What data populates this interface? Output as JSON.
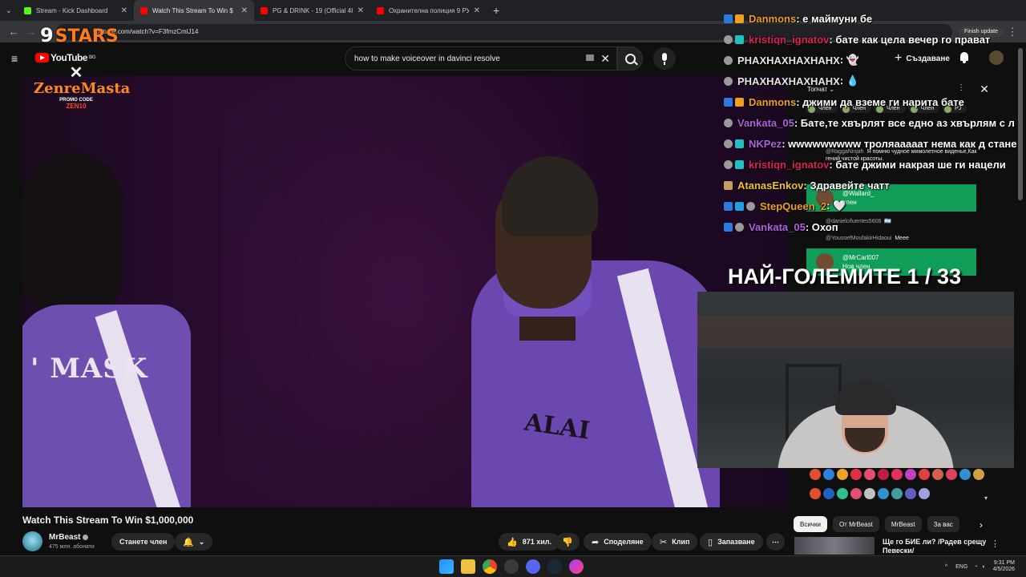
{
  "browser": {
    "tabs": [
      {
        "title": "Stream - Kick Dashboard",
        "color": "#53fc18",
        "active": false
      },
      {
        "title": "Watch This Stream To Win $",
        "color": "#ff0000",
        "active": true
      },
      {
        "title": "PG & DRINK - 19 (Official 4K V",
        "color": "#ff0000",
        "active": false
      },
      {
        "title": "Охранителна полиция 9 РУ | Г",
        "color": "#ff0000",
        "active": false
      }
    ],
    "new_tab": "+",
    "url": "youtube.com/watch?v=F3fmzCmlJ14",
    "finish_update": "Finish update"
  },
  "youtube": {
    "logo_text": "YouTube",
    "logo_region": "BG",
    "search_value": "how to make voiceover in davinci resolve",
    "create_label": "Създаване",
    "video_title": "Watch This Stream To Win $1,000,000",
    "channel_name": "MrBeast",
    "channel_subs": "475 млн. абонати",
    "join_label": "Станете член",
    "likes": "871 хил.",
    "share_label": "Споделяне",
    "clip_label": "Клип",
    "save_label": "Запазване",
    "more_label": "⋯",
    "chips": [
      "Всички",
      "От MrBeast",
      "MrBeast",
      "За вас"
    ],
    "rec_title": "Ще го БИЕ ли? /Радев срещу Певески/"
  },
  "overlay": {
    "stars_num": "9",
    "stars_text": "STARS",
    "zen_x": "✕",
    "zen_name": "ZenreMasta",
    "zen_promo": "PROMO CODE",
    "zen_code": "ZEN10",
    "big_title": "НАЙ-ГОЛЕМИТЕ 1 / 33",
    "top_chat_label": "Топчат",
    "members": [
      "Член",
      "Член",
      "Член",
      "Член",
      "PJ"
    ],
    "side_comments": [
      {
        "user": "@RaggaNinjah",
        "text": "Я помню чудное мимолетное виденье,Как гений чистой красоты."
      },
      {
        "user": "@danielcifuentes5606",
        "text": "🇦🇷"
      },
      {
        "user": "@YoussefMoufakirHidaoui",
        "text": "Meee"
      }
    ],
    "green_comments": [
      {
        "user": "@Wallard_",
        "text": "член"
      },
      {
        "user": "@MrCarl007",
        "text": "Нов член"
      }
    ]
  },
  "chat": [
    {
      "user": "Danmons",
      "color": "#f0a020",
      "text": ": е маймуни бе"
    },
    {
      "user": "kristiqn_ignatov",
      "color": "#e0205a",
      "text": ": бате как цела вечер го прават"
    },
    {
      "user": "PHAXHAXHAXHAHX",
      "color": "#e6e6e6",
      "text": ": 👻"
    },
    {
      "user": "PHAXHAXHAXHAHX",
      "color": "#e6e6e6",
      "text": ": 💧"
    },
    {
      "user": "Danmons",
      "color": "#f0a020",
      "text": ": джими да вземе ги нарита бате"
    },
    {
      "user": "Vankata_05",
      "color": "#b060e0",
      "text": ": Бате,те хвърлят все едно аз хвърлям с л"
    },
    {
      "user": "NKPez",
      "color": "#b060e0",
      "text": ": wwwwwwwww троляааааат нема как д стане"
    },
    {
      "user": "kristiqn_ignatov",
      "color": "#e0205a",
      "text": ": бате джими накрая ше ги нацели"
    },
    {
      "user": "AtanasEnkov",
      "color": "#f0c030",
      "text": ": Здравейте чатт"
    },
    {
      "user": "StepQueen_2",
      "color": "#f0a020",
      "text": ": 🤍"
    },
    {
      "user": "Vankata_05",
      "color": "#b060e0",
      "text": ": Охоп"
    }
  ],
  "taskbar": {
    "lang": "ENG",
    "time": "9:31 PM",
    "date": "4/5/2026"
  }
}
